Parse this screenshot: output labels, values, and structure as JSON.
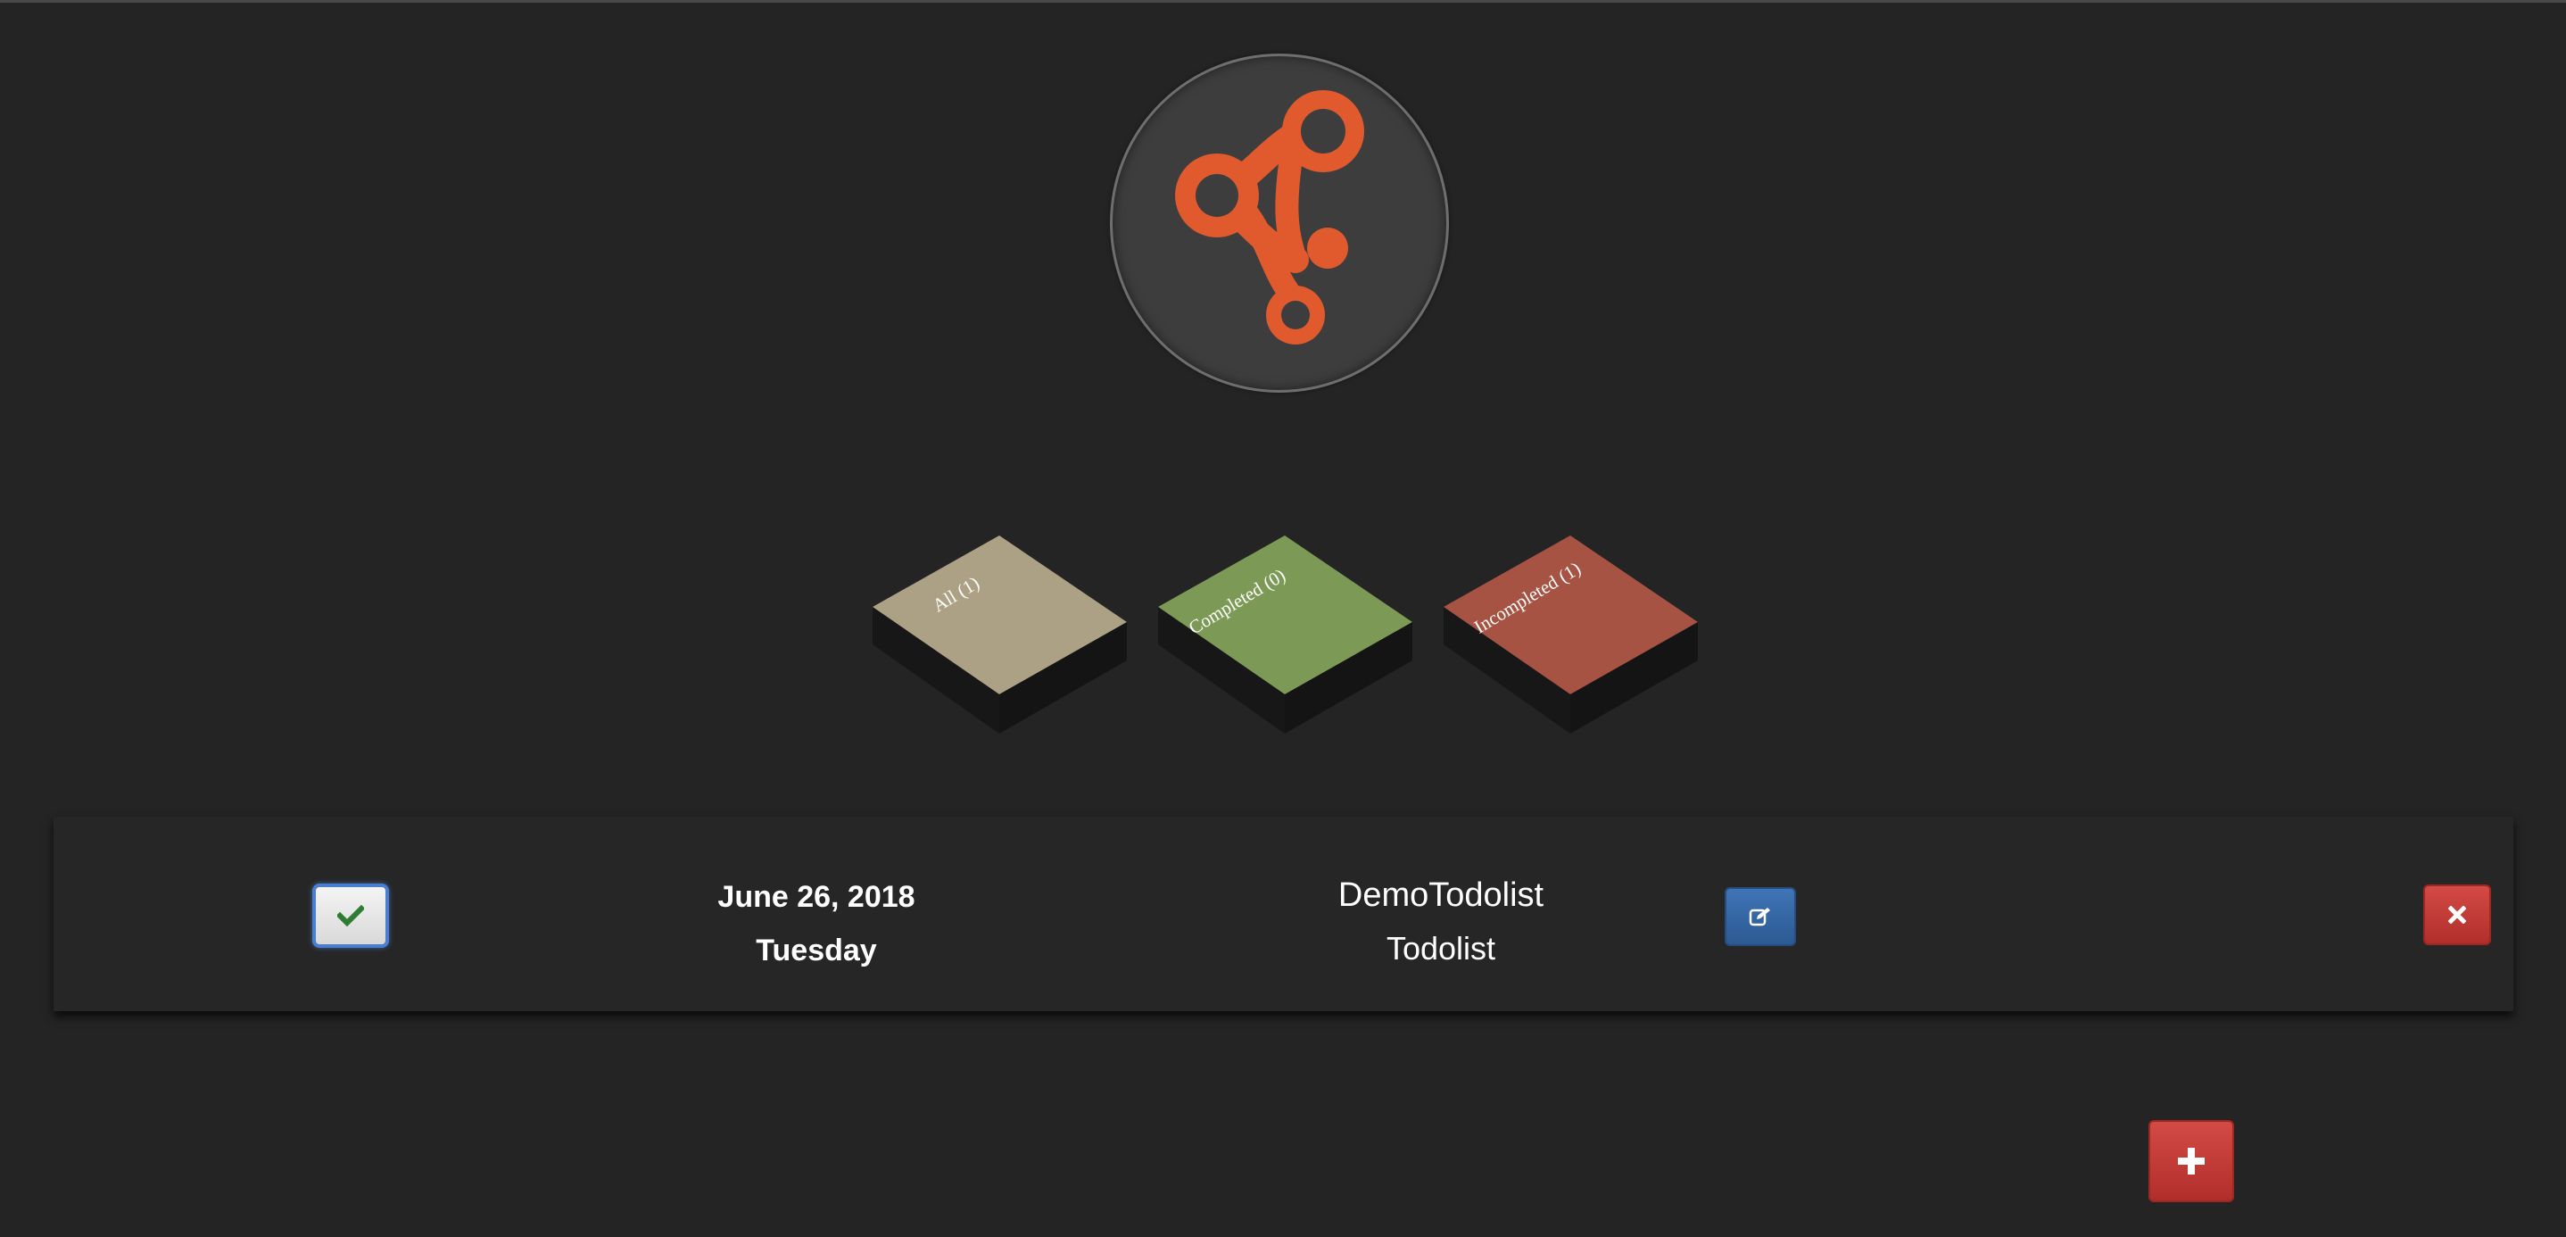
{
  "app": {
    "logo_icon": "network-nodes-logo",
    "colors": {
      "background": "#242424",
      "logo_accent": "#e05a2e",
      "all_filter": "#ada185",
      "completed_filter": "#7c9a55",
      "incompleted_filter": "#a75343",
      "edit_button": "#3569a8",
      "danger_button": "#c13a36"
    }
  },
  "filters": [
    {
      "label": "All (1)",
      "count": 1
    },
    {
      "label": "Completed (0)",
      "count": 0
    },
    {
      "label": "Incompleted (1)",
      "count": 1
    }
  ],
  "todos": [
    {
      "date": "June 26, 2018",
      "weekday": "Tuesday",
      "title": "DemoTodolist",
      "description": "Todolist",
      "completed": false,
      "check_icon": "checkmark-icon",
      "edit_icon": "edit-icon",
      "delete_icon": "close-icon"
    }
  ],
  "add_button": {
    "icon": "plus-icon"
  }
}
